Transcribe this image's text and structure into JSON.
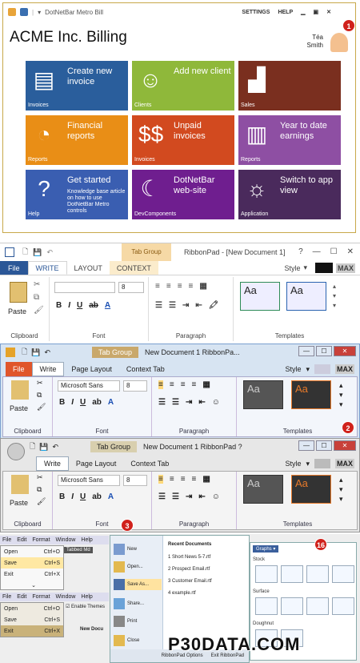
{
  "metro": {
    "window_title": "DotNetBar Metro Bill",
    "settings": "SETTINGS",
    "help": "HELP",
    "app_title": "ACME Inc. Billing",
    "user_first": "Téa",
    "user_last": "Smith",
    "badge": "1",
    "tiles": [
      {
        "title": "Create new invoice",
        "sub": "",
        "caption": "Invoices",
        "color": "#2a5e9c",
        "icon": "document-icon"
      },
      {
        "title": "Add new client",
        "sub": "",
        "caption": "Clients",
        "color": "#8fb83a",
        "icon": "person-icon"
      },
      {
        "title": "",
        "sub": "",
        "caption": "Sales",
        "color": "#7a2f1f",
        "icon": "bar-chart-icon"
      },
      {
        "title": "Financial reports",
        "sub": "",
        "caption": "Reports",
        "color": "#e98e16",
        "icon": "pie-chart-icon"
      },
      {
        "title": "Unpaid invoices",
        "sub": "",
        "caption": "Invoices",
        "color": "#d24a1f",
        "icon": "dollar-icon"
      },
      {
        "title": "Year to date earnings",
        "sub": "",
        "caption": "Reports",
        "color": "#8e4fa3",
        "icon": "report-icon"
      },
      {
        "title": "Get started",
        "sub": "Knowledge base article on how to use DotNetBar Metro controls",
        "caption": "Help",
        "color": "#3a5eb1",
        "icon": "question-icon"
      },
      {
        "title": "DotNetBar web-site",
        "sub": "",
        "caption": "DevComponents",
        "color": "#6f1e8f",
        "icon": "moon-icon"
      },
      {
        "title": "Switch to app view",
        "sub": "",
        "caption": "Application",
        "color": "#4a2a5c",
        "icon": "sun-icon"
      }
    ]
  },
  "ribbon1": {
    "tab_group": "Tab Group",
    "title": "RibbonPad - [New Document 1]",
    "tabs": [
      "File",
      "WRITE",
      "LAYOUT",
      "CONTEXT"
    ],
    "style_label": "Style",
    "max": "MAX",
    "font_size": "8",
    "paste": "Paste",
    "groups": [
      "Clipboard",
      "Font",
      "Paragraph",
      "Templates"
    ]
  },
  "ribbon2": {
    "tab_group": "Tab Group",
    "title": "New Document 1 RibbonPa...",
    "tabs": [
      "File",
      "Write",
      "Page Layout",
      "Context Tab"
    ],
    "style_label": "Style",
    "max": "MAX",
    "font_name": "Microsoft Sans",
    "font_size": "8",
    "paste": "Paste",
    "groups": [
      "Clipboard",
      "Font",
      "Paragraph",
      "Templates"
    ],
    "badge": "2"
  },
  "ribbon3": {
    "tab_group": "Tab Group",
    "title": "New Document 1 RibbonPad ?",
    "tabs": [
      "Write",
      "Page Layout",
      "Context Tab"
    ],
    "style_label": "Style",
    "max": "MAX",
    "font_name": "Microsoft Sans",
    "font_size": "8",
    "paste": "Paste",
    "groups": [
      "Clipboard",
      "Font",
      "Paragraph",
      "Templates"
    ],
    "badge": "3"
  },
  "bottom": {
    "menubar1": [
      "File",
      "Edit",
      "Format",
      "Window",
      "Help"
    ],
    "menu1": [
      {
        "label": "Open",
        "key": "Ctrl+O"
      },
      {
        "label": "Save",
        "key": "Ctrl+S"
      },
      {
        "label": "Exit",
        "key": "Ctrl+X"
      }
    ],
    "tabbed_label": "Tabbed Md",
    "menubar2": [
      "File",
      "Edit",
      "Format",
      "Window",
      "Help"
    ],
    "menu2": [
      {
        "label": "Open",
        "key": "Ctrl+O"
      },
      {
        "label": "Save",
        "key": "Ctrl+S"
      },
      {
        "label": "Exit",
        "key": "Ctrl+X"
      }
    ],
    "enable_themes": "Enable Themes",
    "new_doc": "New Docu",
    "backstage": {
      "items": [
        "New",
        "Open...",
        "Save As...",
        "Share...",
        "Print",
        "Close"
      ],
      "recent_header": "Recent Documents",
      "recent": [
        "1 Short News 5-7.rtf",
        "2 Prospect Email.rtf",
        "3 Customer Email.rtf",
        "4 example.rtf"
      ],
      "options": "RibbonPad Options",
      "exit": "Exit RibbonPad"
    },
    "gallery": {
      "button": "Graphs",
      "sections": [
        "Stock",
        "Surface",
        "Doughnut"
      ],
      "badge": "16"
    },
    "watermark": "P30DATA.COM"
  }
}
